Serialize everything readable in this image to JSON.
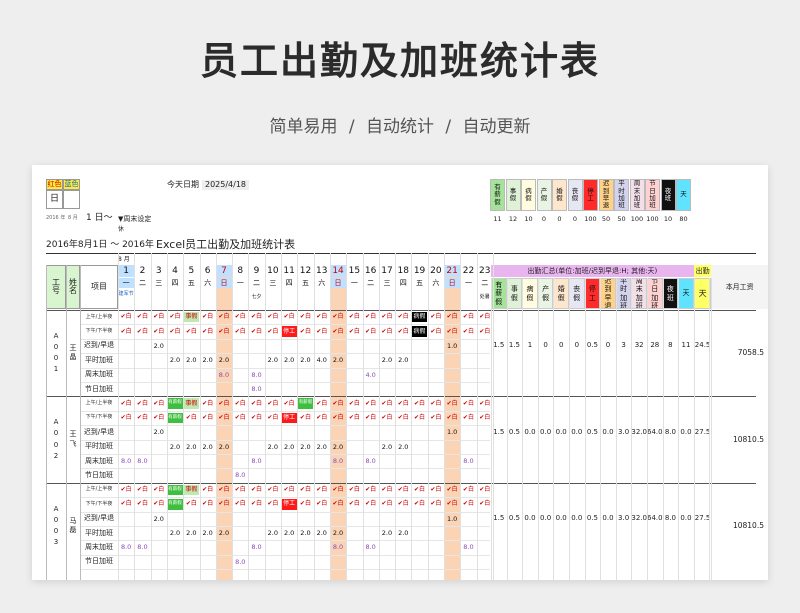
{
  "header": {
    "title": "员工出勤及加班统计表",
    "subtitle": "简单易用 / 自动统计 / 自动更新"
  },
  "sheet": {
    "legend_red": "红色",
    "legend_blue": "蓝色",
    "legend_day": "日",
    "today_label": "今天日期",
    "today_value": "2025/4/18",
    "year_small": "2016 年",
    "month_small": "8 月",
    "start_day": "1 日～",
    "weekend_setting": "▼周末设定",
    "rest_label": "休",
    "period_title": "2016年8月1日 ～ 2016年",
    "sheet_title": "Excel员工出勤及加班统计表",
    "month_label": "8 月",
    "col_id": "工号",
    "col_name": "姓名",
    "col_item": "项目",
    "summary_header": "出勤汇总(单位:加班/迟到早退:H; 其他:天)",
    "attend_header": "出勤",
    "salary_header": "本月工资",
    "holiday_notes": {
      "army_day": "建军节",
      "qixi": "七夕",
      "handling": "处暑"
    },
    "legend_codes": [
      {
        "label": "有薪假",
        "count": "11",
        "color": "#a5e39a"
      },
      {
        "label": "事假",
        "count": "12",
        "color": "#dff2d8"
      },
      {
        "label": "病假",
        "count": "10",
        "color": "#fffce0"
      },
      {
        "label": "产假",
        "count": "0",
        "color": "#eaf4e5"
      },
      {
        "label": "婚假",
        "count": "0",
        "color": "#fde6cc"
      },
      {
        "label": "丧假",
        "count": "0",
        "color": "#e7e7f4"
      },
      {
        "label": "停工",
        "count": "100",
        "color": "#ff2a2a"
      },
      {
        "label": "迟到早退",
        "count": "50",
        "color": "#ffd28a"
      },
      {
        "label": "平时加班",
        "count": "50",
        "color": "#d3d3ee"
      },
      {
        "label": "周末加班",
        "count": "100",
        "color": "#f2dfe8"
      },
      {
        "label": "节日加班",
        "count": "100",
        "color": "#ffd1d1"
      },
      {
        "label": "夜班",
        "count": "10",
        "color": "#111111"
      },
      {
        "label": "天",
        "count": "80",
        "color": "#5fe3ff"
      }
    ],
    "days": [
      "1",
      "2",
      "3",
      "4",
      "5",
      "6",
      "7",
      "8",
      "9",
      "10",
      "11",
      "12",
      "13",
      "14",
      "15",
      "16",
      "17",
      "18",
      "19",
      "20",
      "21",
      "22",
      "23"
    ],
    "weekdays": [
      "一",
      "二",
      "三",
      "四",
      "五",
      "六",
      "日",
      "一",
      "二",
      "三",
      "四",
      "五",
      "六",
      "日",
      "一",
      "二",
      "三",
      "四",
      "五",
      "六",
      "日",
      "一",
      "二"
    ],
    "summary_cols": [
      "有薪假",
      "事假",
      "病假",
      "产假",
      "婚假",
      "丧假",
      "停工",
      "迟到早退",
      "平时加班",
      "周末加班",
      "节日加班",
      "夜班",
      "天"
    ],
    "row_items": [
      "上午/上半夜",
      "下午/下半夜",
      "迟到/早退",
      "平时加班",
      "周末加班",
      "节日加班"
    ],
    "employees": [
      {
        "id": "A001",
        "name": "王晶",
        "summary": [
          "1.5",
          "1.5",
          "1",
          "0",
          "0",
          "0",
          "0.5",
          "0",
          "3",
          "32",
          "28",
          "8",
          "11",
          "24.5"
        ],
        "salary": "7058.5",
        "am": [
          "✔白",
          "✔白",
          "✔白",
          "✔白",
          "事假",
          "✔白",
          "✔白",
          "✔白",
          "✔白",
          "✔白",
          "✔白",
          "✔白",
          "✔白",
          "✔白",
          "✔白",
          "✔白",
          "✔白",
          "✔白",
          "病假",
          "✔白",
          "✔白",
          "✔白",
          "✔白"
        ],
        "pm": [
          "✔白",
          "✔白",
          "✔白",
          "✔白",
          "✔白",
          "✔白",
          "✔白",
          "✔白",
          "✔白",
          "✔白",
          "停工",
          "✔白",
          "✔白",
          "✔白",
          "✔白",
          "✔白",
          "✔白",
          "✔白",
          "病假",
          "✔白",
          "✔白",
          "✔白",
          "✔白"
        ],
        "late": {
          "3": "2.0",
          "21": "1.0"
        },
        "weekday_ot": {
          "4": "2.0",
          "5": "2.0",
          "6": "2.0",
          "7": "2.0",
          "10": "2.0",
          "11": "2.0",
          "12": "2.0",
          "13": "4.0",
          "14": "2.0",
          "17": "2.0",
          "18": "2.0"
        },
        "weekend_ot": {
          "7": "8.0",
          "9": "8.0",
          "16": "4.0"
        },
        "holiday_ot": {
          "9": "8.0"
        }
      },
      {
        "id": "A002",
        "name": "王飞",
        "summary": [
          "1.5",
          "0.5",
          "0.0",
          "0.0",
          "0.0",
          "0.0",
          "0.5",
          "0.0",
          "3.0",
          "32.0",
          "64.0",
          "8.0",
          "0.0",
          "27.5"
        ],
        "salary": "10810.5",
        "am": [
          "✔白",
          "✔白",
          "✔白",
          "有薪假",
          "事假",
          "✔白",
          "✔白",
          "✔白",
          "✔白",
          "✔白",
          "✔白",
          "有薪假",
          "✔白",
          "✔白",
          "✔白",
          "✔白",
          "✔白",
          "✔白",
          "✔白",
          "✔白",
          "✔白",
          "✔白",
          "✔白"
        ],
        "pm": [
          "✔白",
          "✔白",
          "✔白",
          "有薪假",
          "✔白",
          "✔白",
          "✔白",
          "✔白",
          "✔白",
          "✔白",
          "停工",
          "✔白",
          "✔白",
          "✔白",
          "✔白",
          "✔白",
          "✔白",
          "✔白",
          "✔白",
          "✔白",
          "✔白",
          "✔白",
          "✔白"
        ],
        "late": {
          "3": "2.0",
          "21": "1.0"
        },
        "weekday_ot": {
          "4": "2.0",
          "5": "2.0",
          "6": "2.0",
          "7": "2.0",
          "10": "2.0",
          "11": "2.0",
          "12": "2.0",
          "13": "2.0",
          "14": "2.0",
          "17": "2.0",
          "18": "2.0"
        },
        "weekend_ot": {
          "1": "8.0",
          "2": "8.0",
          "9": "8.0",
          "14": "8.0",
          "16": "8.0",
          "22": "8.0"
        },
        "holiday_ot": {
          "8": "8.0"
        }
      },
      {
        "id": "A003",
        "name": "马磊",
        "summary": [
          "1.5",
          "0.5",
          "0.0",
          "0.0",
          "0.0",
          "0.0",
          "0.5",
          "0.0",
          "3.0",
          "32.0",
          "64.0",
          "8.0",
          "0.0",
          "27.5"
        ],
        "salary": "10810.5",
        "am": [
          "✔白",
          "✔白",
          "✔白",
          "有薪假",
          "事假",
          "✔白",
          "✔白",
          "✔白",
          "✔白",
          "✔白",
          "✔白",
          "✔白",
          "✔白",
          "✔白",
          "✔白",
          "✔白",
          "✔白",
          "✔白",
          "✔白",
          "✔白",
          "✔白",
          "✔白",
          "✔白"
        ],
        "pm": [
          "✔白",
          "✔白",
          "✔白",
          "有薪假",
          "✔白",
          "✔白",
          "✔白",
          "✔白",
          "✔白",
          "✔白",
          "停工",
          "✔白",
          "✔白",
          "✔白",
          "✔白",
          "✔白",
          "✔白",
          "✔白",
          "✔白",
          "✔白",
          "✔白",
          "✔白",
          "✔白"
        ],
        "late": {
          "3": "2.0",
          "21": "1.0"
        },
        "weekday_ot": {
          "4": "2.0",
          "5": "2.0",
          "6": "2.0",
          "7": "2.0",
          "10": "2.0",
          "11": "2.0",
          "12": "2.0",
          "13": "2.0",
          "14": "2.0",
          "17": "2.0",
          "18": "2.0"
        },
        "weekend_ot": {
          "1": "8.0",
          "2": "8.0",
          "9": "8.0",
          "14": "8.0",
          "16": "8.0",
          "22": "8.0"
        },
        "holiday_ot": {
          "8": "8.0"
        }
      }
    ]
  }
}
